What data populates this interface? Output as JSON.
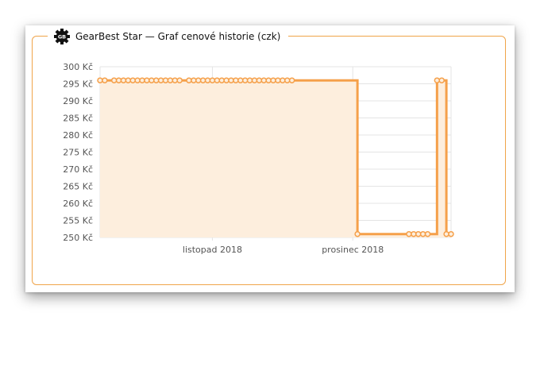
{
  "widget": {
    "title": "GearBest Star — Graf cenové historie (czk)",
    "logo_icon": "gear-icon",
    "logo_text": "GB"
  },
  "colors": {
    "accent": "#f0a449",
    "line": "#f5a04a",
    "fill": "#fdeedd",
    "grid": "#e4e4e4"
  },
  "chart_data": {
    "type": "area",
    "title": "GearBest Star — Graf cenové historie (czk)",
    "xlabel": "",
    "ylabel": "",
    "step": true,
    "grid": true,
    "y_unit": "Kč",
    "ylim": [
      250,
      300
    ],
    "yticks": [
      "300 Kč",
      "295 Kč",
      "290 Kč",
      "285 Kč",
      "280 Kč",
      "275 Kč",
      "270 Kč",
      "265 Kč",
      "260 Kč",
      "255 Kč",
      "250 Kč"
    ],
    "xlim": [
      "2018-10-08",
      "2018-12-22"
    ],
    "xticks": [
      {
        "date": "2018-11-01",
        "label": "listopad 2018"
      },
      {
        "date": "2018-12-01",
        "label": "prosinec 2018"
      }
    ],
    "series": [
      {
        "name": "",
        "points": [
          [
            "2018-10-08",
            296
          ],
          [
            "2018-10-09",
            296
          ],
          [
            "2018-10-11",
            296
          ],
          [
            "2018-10-12",
            296
          ],
          [
            "2018-10-13",
            296
          ],
          [
            "2018-10-14",
            296
          ],
          [
            "2018-10-15",
            296
          ],
          [
            "2018-10-16",
            296
          ],
          [
            "2018-10-17",
            296
          ],
          [
            "2018-10-18",
            296
          ],
          [
            "2018-10-19",
            296
          ],
          [
            "2018-10-20",
            296
          ],
          [
            "2018-10-21",
            296
          ],
          [
            "2018-10-22",
            296
          ],
          [
            "2018-10-23",
            296
          ],
          [
            "2018-10-24",
            296
          ],
          [
            "2018-10-25",
            296
          ],
          [
            "2018-10-27",
            296
          ],
          [
            "2018-10-28",
            296
          ],
          [
            "2018-10-29",
            296
          ],
          [
            "2018-10-30",
            296
          ],
          [
            "2018-10-31",
            296
          ],
          [
            "2018-11-01",
            296
          ],
          [
            "2018-11-02",
            296
          ],
          [
            "2018-11-03",
            296
          ],
          [
            "2018-11-04",
            296
          ],
          [
            "2018-11-05",
            296
          ],
          [
            "2018-11-06",
            296
          ],
          [
            "2018-11-07",
            296
          ],
          [
            "2018-11-08",
            296
          ],
          [
            "2018-11-09",
            296
          ],
          [
            "2018-11-10",
            296
          ],
          [
            "2018-11-11",
            296
          ],
          [
            "2018-11-12",
            296
          ],
          [
            "2018-11-13",
            296
          ],
          [
            "2018-11-14",
            296
          ],
          [
            "2018-11-15",
            296
          ],
          [
            "2018-11-16",
            296
          ],
          [
            "2018-11-17",
            296
          ],
          [
            "2018-11-18",
            296
          ],
          [
            "2018-12-02",
            251
          ],
          [
            "2018-12-13",
            251
          ],
          [
            "2018-12-14",
            251
          ],
          [
            "2018-12-15",
            251
          ],
          [
            "2018-12-16",
            251
          ],
          [
            "2018-12-17",
            251
          ],
          [
            "2018-12-19",
            296
          ],
          [
            "2018-12-20",
            296
          ],
          [
            "2018-12-21",
            251
          ],
          [
            "2018-12-22",
            251
          ]
        ]
      }
    ]
  }
}
